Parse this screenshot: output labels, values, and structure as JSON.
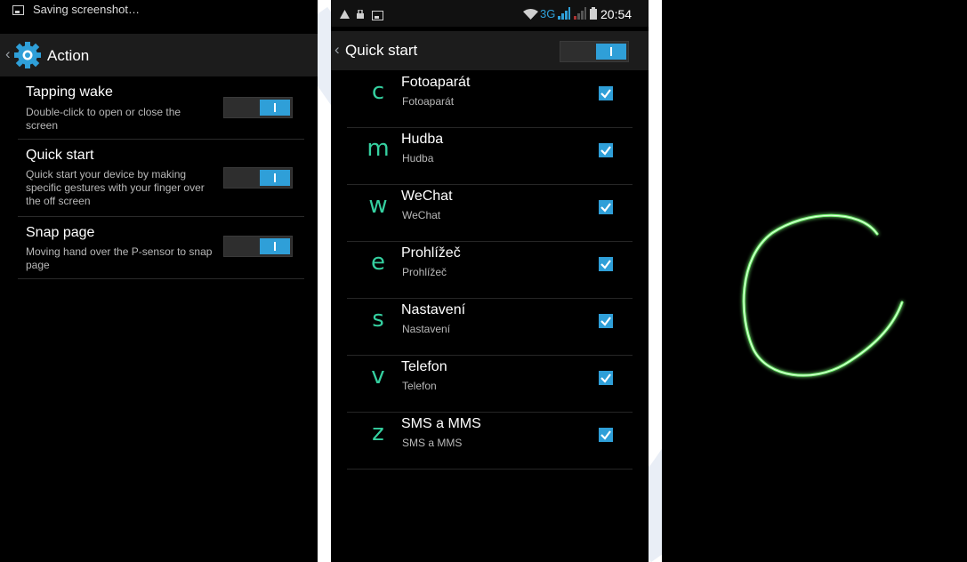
{
  "screen1": {
    "status": {
      "text": "Saving screenshot…"
    },
    "title": "Action",
    "settings": [
      {
        "title": "Tapping wake",
        "desc": "Double-click to open or close the screen",
        "enabled": true
      },
      {
        "title": "Quick start",
        "desc": "Quick start your device by making specific gestures with your finger over the off screen",
        "enabled": true
      },
      {
        "title": "Snap page",
        "desc": "Moving hand over the P-sensor to snap page",
        "enabled": true
      }
    ]
  },
  "screen2": {
    "status": {
      "network": "3G",
      "time": "20:54"
    },
    "title": "Quick start",
    "master_enabled": true,
    "apps": [
      {
        "letter": "c",
        "name": "Fotoaparát",
        "sub": "Fotoaparát",
        "checked": true
      },
      {
        "letter": "m",
        "name": "Hudba",
        "sub": "Hudba",
        "checked": true
      },
      {
        "letter": "w",
        "name": "WeChat",
        "sub": "WeChat",
        "checked": true
      },
      {
        "letter": "e",
        "name": "Prohlížeč",
        "sub": "Prohlížeč",
        "checked": true
      },
      {
        "letter": "s",
        "name": "Nastavení",
        "sub": "Nastavení",
        "checked": true
      },
      {
        "letter": "v",
        "name": "Telefon",
        "sub": "Telefon",
        "checked": true
      },
      {
        "letter": "z",
        "name": "SMS a MMS",
        "sub": "SMS a MMS",
        "checked": true
      }
    ]
  },
  "screen3": {
    "gesture_trail": "c",
    "trail_color": "#7dff7a"
  },
  "colors": {
    "accent": "#2f9fd8",
    "gesture_letter": "#35d0a0",
    "actionbar": "#1c1c1c"
  }
}
